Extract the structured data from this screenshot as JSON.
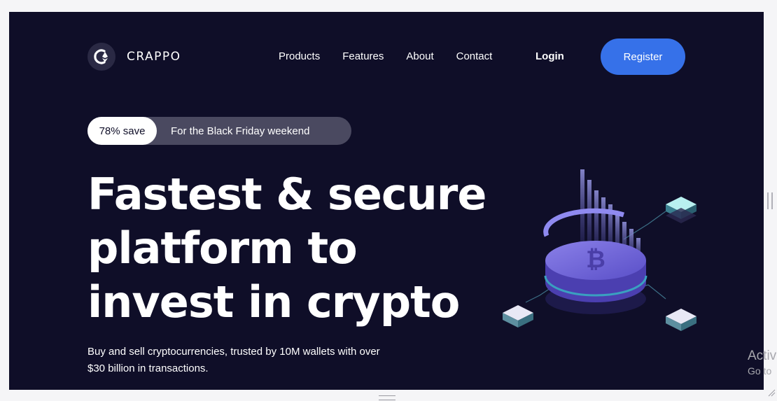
{
  "brand": {
    "name": "CRAPPO",
    "icon": "crappo-logo-icon"
  },
  "nav": {
    "items": [
      "Products",
      "Features",
      "About",
      "Contact"
    ],
    "login_label": "Login",
    "register_label": "Register"
  },
  "promo": {
    "badge": "78% save",
    "text": "For the Black Friday weekend"
  },
  "hero": {
    "title": "Fastest & secure platform to invest in crypto",
    "subtitle": "Buy and sell cryptocurrencies, trusted by 10M wallets with over $30 billion in transactions.",
    "illustration": "isometric-bitcoin-coin-illustration"
  },
  "watermark": {
    "line1": "Activ",
    "line2": "Go to"
  },
  "colors": {
    "background": "#0f0e28",
    "accent": "#3671e9",
    "promo_pill": "#4a4960"
  }
}
